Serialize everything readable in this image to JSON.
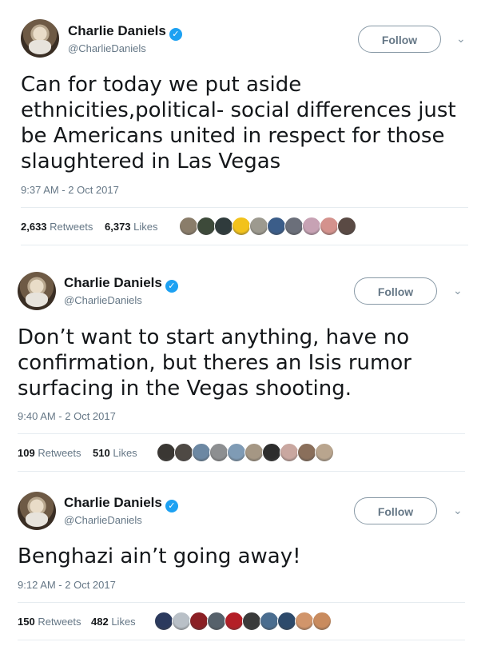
{
  "tweets": [
    {
      "name": "Charlie Daniels",
      "handle": "@CharlieDaniels",
      "follow_label": "Follow",
      "text": "Can for today we put aside ethnicities,political- social differences just be Americans united in respect for those slaughtered in Las Vegas",
      "time": "9:37 AM - 2 Oct 2017",
      "retweets": "2,633",
      "retweets_label": "Retweets",
      "likes": "6,373",
      "likes_label": "Likes",
      "liker_colors": [
        "#8a7d6a",
        "#3d4a3a",
        "#2f3b3c",
        "#f2c21b",
        "#9d9a8f",
        "#3b5d89",
        "#6b6f7a",
        "#c7a2b4",
        "#d4928d",
        "#5a4a44"
      ]
    },
    {
      "name": "Charlie Daniels",
      "handle": "@CharlieDaniels",
      "follow_label": "Follow",
      "text": "Don’t want to start anything, have no confirmation, but theres an Isis rumor surfacing in the Vegas shooting.",
      "time": "9:40 AM - 2 Oct 2017",
      "retweets": "109",
      "retweets_label": "Retweets",
      "likes": "510",
      "likes_label": "Likes",
      "liker_colors": [
        "#3a3733",
        "#4e4944",
        "#6c88a3",
        "#8d8f91",
        "#7f9bb5",
        "#a59784",
        "#2d2d2d",
        "#c9a7a0",
        "#8a6f5b",
        "#b9a58e"
      ]
    },
    {
      "name": "Charlie Daniels",
      "handle": "@CharlieDaniels",
      "follow_label": "Follow",
      "text": "Benghazi ain’t going away!",
      "time": "9:12 AM - 2 Oct 2017",
      "retweets": "150",
      "retweets_label": "Retweets",
      "likes": "482",
      "likes_label": "Likes",
      "liker_colors": [
        "#2b3a5e",
        "#b9c0c7",
        "#8b1f24",
        "#56616b",
        "#b41f27",
        "#3a3a3a",
        "#4a6d8f",
        "#2d4a6b",
        "#d1956b",
        "#c98b5e"
      ]
    }
  ]
}
